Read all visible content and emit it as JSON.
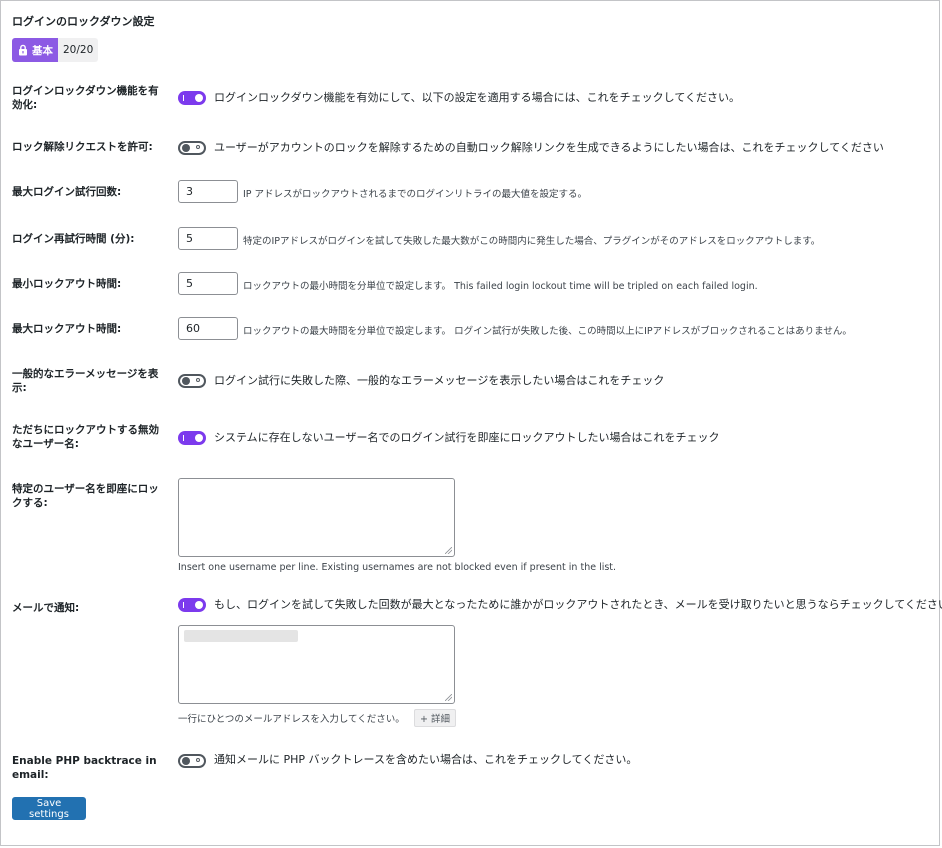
{
  "section": {
    "title": "ログインのロックダウン設定",
    "badge_level": "基本",
    "badge_score": "20/20"
  },
  "rows": {
    "enable": {
      "label": "ログインロックダウン機能を有効化:",
      "toggle": "on",
      "desc": "ログインロックダウン機能を有効にして、以下の設定を適用する場合には、これをチェックしてください。"
    },
    "unlock": {
      "label": "ロック解除リクエストを許可:",
      "toggle": "off",
      "desc": "ユーザーがアカウントのロックを解除するための自動ロック解除リンクを生成できるようにしたい場合は、これをチェックしてください"
    },
    "max_attempts": {
      "label": "最大ログイン試行回数:",
      "value": "3",
      "desc": "IP アドレスがロックアウトされるまでのログインリトライの最大値を設定する。"
    },
    "retry_period": {
      "label": "ログイン再試行時間 (分):",
      "value": "5",
      "desc": "特定のIPアドレスがログインを試して失敗した最大数がこの時間内に発生した場合、プラグインがそのアドレスをロックアウトします。"
    },
    "min_lockout": {
      "label": "最小ロックアウト時間:",
      "value": "5",
      "desc": "ロックアウトの最小時間を分単位で設定します。 This failed login lockout time will be tripled on each failed login."
    },
    "max_lockout": {
      "label": "最大ロックアウト時間:",
      "value": "60",
      "desc": "ロックアウトの最大時間を分単位で設定します。 ログイン試行が失敗した後、この時間以上にIPアドレスがブロックされることはありません。"
    },
    "generic_error": {
      "label": "一般的なエラーメッセージを表示:",
      "toggle": "off",
      "desc": "ログイン試行に失敗した際、一般的なエラーメッセージを表示したい場合はこれをチェック"
    },
    "invalid_usernames": {
      "label": "ただちにロックアウトする無効なユーザー名:",
      "toggle": "on",
      "desc": "システムに存在しないユーザー名でのログイン試行を即座にロックアウトしたい場合はこれをチェック"
    },
    "block_usernames": {
      "label": "特定のユーザー名を即座にロックする:",
      "hint": "Insert one username per line. Existing usernames are not blocked even if present in the list."
    },
    "email_notify": {
      "label": "メールで通知:",
      "toggle": "on",
      "desc": "もし、ログインを試して失敗した回数が最大となったために誰かがロックアウトされたとき、メールを受け取りたいと思うならチェックしてください。",
      "hint": "一行にひとつのメールアドレスを入力してください。",
      "more_label": "+ 詳細"
    },
    "php_backtrace": {
      "label": "Enable PHP backtrace in email:",
      "toggle": "off",
      "desc": "通知メールに PHP バックトレースを含めたい場合は、これをチェックしてください。"
    }
  },
  "save_label": "Save settings",
  "colors": {
    "toggle_on": "#7c3aed",
    "badge": "#8c5ae4",
    "primary_button": "#2271b1"
  }
}
